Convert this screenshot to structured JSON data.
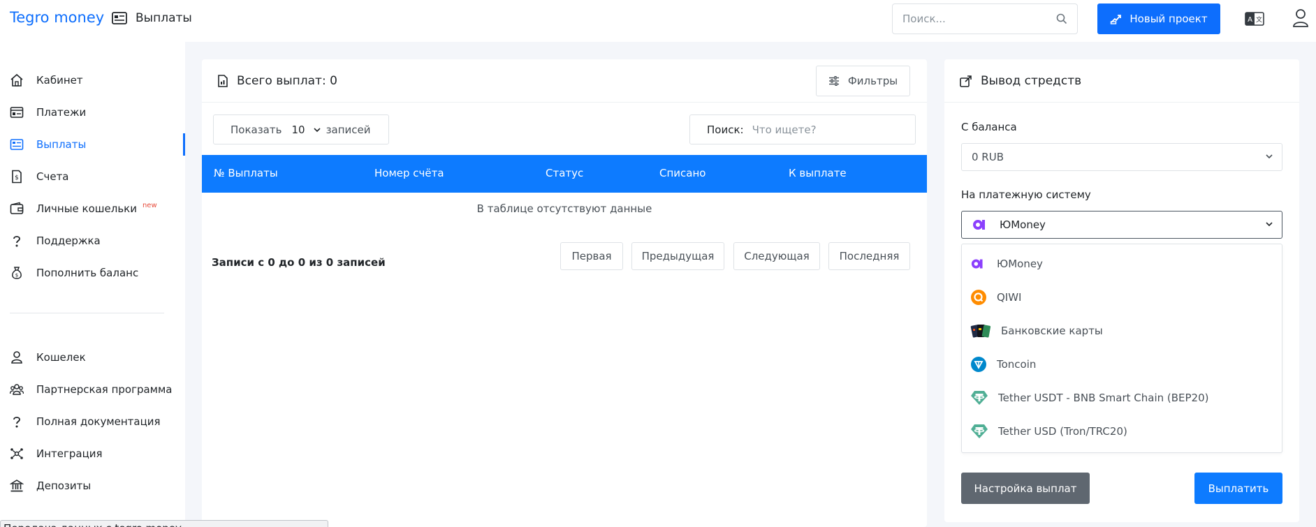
{
  "header": {
    "brand": "Tegro money",
    "page_title": "Выплаты",
    "search_placeholder": "Поиск...",
    "new_project_label": "Новый проект"
  },
  "sidebar": {
    "items": [
      {
        "label": "Кабинет",
        "icon": "home-icon"
      },
      {
        "label": "Платежи",
        "icon": "payments-icon"
      },
      {
        "label": "Выплаты",
        "icon": "payouts-icon",
        "active": true
      },
      {
        "label": "Счета",
        "icon": "invoice-icon"
      },
      {
        "label": "Личные кошельки",
        "icon": "wallet-icon",
        "badge": "new"
      },
      {
        "label": "Поддержка",
        "icon": "support-icon"
      },
      {
        "label": "Пополнить баланс",
        "icon": "money-bag-icon"
      }
    ],
    "items2": [
      {
        "label": "Кошелек",
        "icon": "user-icon"
      },
      {
        "label": "Партнерская программа",
        "icon": "users-icon"
      },
      {
        "label": "Полная документация",
        "icon": "docs-icon"
      },
      {
        "label": "Интеграция",
        "icon": "integration-icon"
      },
      {
        "label": "Депозиты",
        "icon": "bank-icon"
      }
    ]
  },
  "payouts": {
    "title": "Всего выплат: 0",
    "filters_label": "Фильтры",
    "show_label": "Показать",
    "page_length": "10",
    "records_label": "записей",
    "search_label": "Поиск:",
    "search_placeholder": "Что ищете?",
    "columns": [
      "№ Выплаты",
      "Номер счёта",
      "Статус",
      "Списано",
      "К выплате"
    ],
    "empty_text": "В таблице отсутствуют данные",
    "info_text": "Записи с 0 до 0 из 0 записей",
    "pager": {
      "first": "Первая",
      "prev": "Предыдущая",
      "next": "Следующая",
      "last": "Последняя"
    }
  },
  "withdraw": {
    "title": "Вывод стредств",
    "from_balance_label": "С баланса",
    "balance_value": "0 RUB",
    "system_label": "На платежную систему",
    "selected_system": "ЮMoney",
    "options": [
      "ЮMoney",
      "QIWI",
      "Банковские карты",
      "Toncoin",
      "Tether USDT - BNB Smart Chain (BEP20)",
      "Tether USD (Tron/TRC20)"
    ],
    "settings_button": "Настройка выплат",
    "pay_button": "Выплатить"
  },
  "status_bar": {
    "text": "Передача данных с tegro.money..."
  },
  "colors": {
    "primary": "#0d6efd",
    "table_header": "#0d7bff",
    "secondary_button": "#5f6770",
    "yoomoney": "#8b3ffd",
    "qiwi": "#ff8c00",
    "toncoin": "#0088cc",
    "tether": "#50af95"
  }
}
